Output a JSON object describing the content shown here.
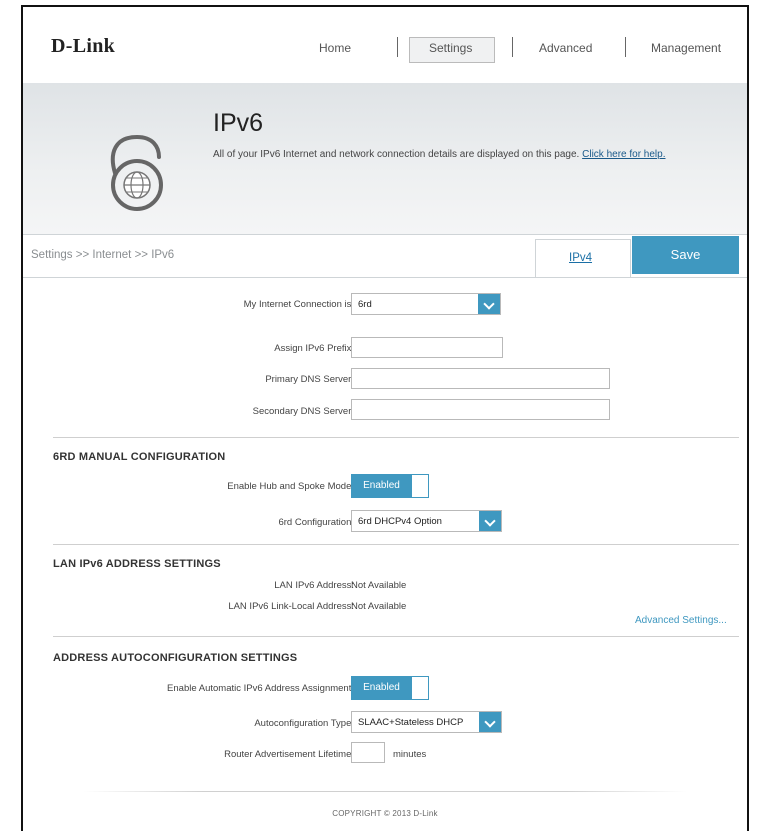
{
  "brand": {
    "logo": "D-Link"
  },
  "nav": {
    "items": [
      "Home",
      "Settings",
      "Advanced",
      "Management"
    ],
    "active": "Settings"
  },
  "hero": {
    "title": "IPv6",
    "description": "All of your IPv6 Internet and network connection details are displayed on this page.",
    "help_link": "Click here for help.",
    "icon": "lock-6-globe-icon"
  },
  "breadcrumb": "Settings >> Internet >> IPv6",
  "tabs": {
    "ipv4": "IPv4",
    "save": "Save"
  },
  "connection": {
    "label": "My Internet Connection is:",
    "value": "6rd",
    "prefix_label": "Assign IPv6 Prefix:",
    "prefix_value": "",
    "primary_dns_label": "Primary DNS Server:",
    "primary_dns_value": "",
    "secondary_dns_label": "Secondary DNS Server:",
    "secondary_dns_value": ""
  },
  "manual": {
    "title": "6RD MANUAL CONFIGURATION",
    "hub_label": "Enable Hub and Spoke Mode:",
    "hub_value": "Enabled",
    "config_label": "6rd Configuration:",
    "config_value": "6rd DHCPv4 Option"
  },
  "lan": {
    "title": "LAN IPv6 ADDRESS SETTINGS",
    "address_label": "LAN IPv6 Address:",
    "address_value": "Not Available",
    "link_local_label": "LAN IPv6 Link-Local Address:",
    "link_local_value": "Not Available",
    "advanced_link": "Advanced Settings..."
  },
  "autoconfig": {
    "title": "ADDRESS AUTOCONFIGURATION SETTINGS",
    "enable_label": "Enable Automatic IPv6 Address Assignment:",
    "enable_value": "Enabled",
    "type_label": "Autoconfiguration Type:",
    "type_value": "SLAAC+Stateless DHCP",
    "lifetime_label": "Router Advertisement Lifetime:",
    "lifetime_value": "",
    "lifetime_unit": "minutes"
  },
  "footer": {
    "copyright": "COPYRIGHT © 2013 D-Link"
  },
  "colors": {
    "accent": "#3f98c0",
    "link": "#1a6fa6"
  }
}
